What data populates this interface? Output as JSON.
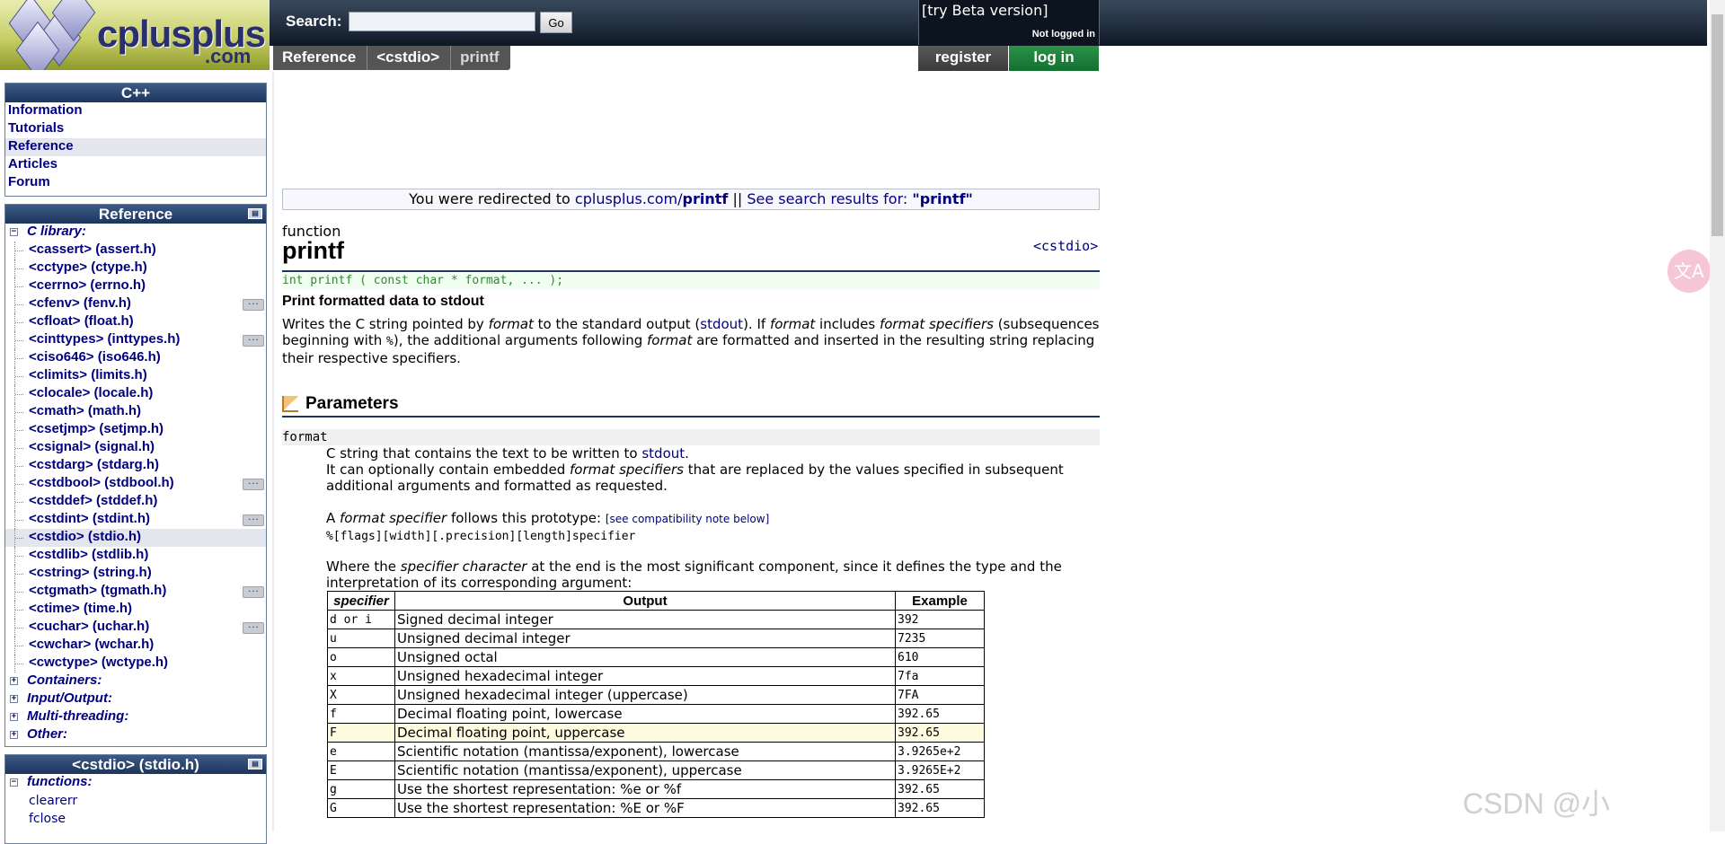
{
  "header": {
    "logo_text": "cplusplus",
    "logo_suffix": ".com",
    "search_label": "Search:",
    "search_value": "",
    "go_label": "Go",
    "beta_link": "[try Beta version]",
    "login_status": "Not logged in",
    "register_label": "register",
    "login_label": "log in"
  },
  "breadcrumb": [
    "Reference",
    "<cstdio>",
    "printf"
  ],
  "sidebar": {
    "cpp_box": {
      "title": "C++",
      "items": [
        {
          "label": "Information",
          "selected": false
        },
        {
          "label": "Tutorials",
          "selected": false
        },
        {
          "label": "Reference",
          "selected": true
        },
        {
          "label": "Articles",
          "selected": false
        },
        {
          "label": "Forum",
          "selected": false
        }
      ]
    },
    "reference_box": {
      "title": "Reference",
      "category": "C library:",
      "headers": [
        {
          "label": "<cassert> (assert.h)",
          "cpp11": false
        },
        {
          "label": "<cctype> (ctype.h)",
          "cpp11": false
        },
        {
          "label": "<cerrno> (errno.h)",
          "cpp11": false
        },
        {
          "label": "<cfenv> (fenv.h)",
          "cpp11": true
        },
        {
          "label": "<cfloat> (float.h)",
          "cpp11": false
        },
        {
          "label": "<cinttypes> (inttypes.h)",
          "cpp11": true
        },
        {
          "label": "<ciso646> (iso646.h)",
          "cpp11": false
        },
        {
          "label": "<climits> (limits.h)",
          "cpp11": false
        },
        {
          "label": "<clocale> (locale.h)",
          "cpp11": false
        },
        {
          "label": "<cmath> (math.h)",
          "cpp11": false
        },
        {
          "label": "<csetjmp> (setjmp.h)",
          "cpp11": false
        },
        {
          "label": "<csignal> (signal.h)",
          "cpp11": false
        },
        {
          "label": "<cstdarg> (stdarg.h)",
          "cpp11": false
        },
        {
          "label": "<cstdbool> (stdbool.h)",
          "cpp11": true
        },
        {
          "label": "<cstddef> (stddef.h)",
          "cpp11": false
        },
        {
          "label": "<cstdint> (stdint.h)",
          "cpp11": true
        },
        {
          "label": "<cstdio> (stdio.h)",
          "cpp11": false,
          "selected": true
        },
        {
          "label": "<cstdlib> (stdlib.h)",
          "cpp11": false
        },
        {
          "label": "<cstring> (string.h)",
          "cpp11": false
        },
        {
          "label": "<ctgmath> (tgmath.h)",
          "cpp11": true
        },
        {
          "label": "<ctime> (time.h)",
          "cpp11": false
        },
        {
          "label": "<cuchar> (uchar.h)",
          "cpp11": true
        },
        {
          "label": "<cwchar> (wchar.h)",
          "cpp11": false
        },
        {
          "label": "<cwctype> (wctype.h)",
          "cpp11": false
        }
      ],
      "other_categories": [
        "Containers:",
        "Input/Output:",
        "Multi-threading:",
        "Other:"
      ]
    },
    "cstdio_box": {
      "title": "<cstdio> (stdio.h)",
      "category": "functions:",
      "functions": [
        "clearerr",
        "fclose"
      ]
    }
  },
  "main": {
    "redirect": {
      "prefix": "You were redirected to ",
      "link1_host": "cplusplus.com/",
      "link1_page": "printf",
      "separator": " || ",
      "link2": "See search results for: ",
      "query": "\"printf\""
    },
    "kind": "function",
    "title": "printf",
    "header_tag": "<cstdio>",
    "prototype": "int printf ( const char * format, ... );",
    "short_description": "Print formatted data to stdout",
    "description": {
      "t1": "Writes the C string pointed by ",
      "t2": "format",
      "t3": " to the standard output (",
      "t4": "stdout",
      "t5": "). If ",
      "t6": "format",
      "t7": " includes ",
      "t8": "format specifiers",
      "t9": " (subsequences beginning with ",
      "t10": "%",
      "t11": "), the additional arguments following ",
      "t12": "format",
      "t13": " are formatted and inserted in the resulting string replacing their respective specifiers."
    },
    "parameters_title": "Parameters",
    "param_name": "format",
    "param": {
      "l1a": "C string that contains the text to be written to ",
      "l1b": "stdout",
      "l1c": ".",
      "l2a": "It can optionally contain embedded ",
      "l2b": "format specifiers",
      "l2c": " that are replaced by the values specified in subsequent additional arguments and formatted as requested.",
      "l3a": "A ",
      "l3b": "format specifier",
      "l3c": " follows this prototype: ",
      "l3d": "[see compatibility note below]",
      "proto": "%[flags][width][.precision][length]specifier",
      "l4a": "Where the ",
      "l4b": "specifier character",
      "l4c": " at the end is the most significant component, since it defines the type and the interpretation of its corresponding argument:"
    },
    "table": {
      "headers": [
        "specifier",
        "Output",
        "Example"
      ],
      "rows": [
        {
          "spec": "d or i",
          "output": "Signed decimal integer",
          "example": "392",
          "hl": false
        },
        {
          "spec": "u",
          "output": "Unsigned decimal integer",
          "example": "7235",
          "hl": false
        },
        {
          "spec": "o",
          "output": "Unsigned octal",
          "example": "610",
          "hl": false
        },
        {
          "spec": "x",
          "output": "Unsigned hexadecimal integer",
          "example": "7fa",
          "hl": false
        },
        {
          "spec": "X",
          "output": "Unsigned hexadecimal integer (uppercase)",
          "example": "7FA",
          "hl": false
        },
        {
          "spec": "f",
          "output": "Decimal floating point, lowercase",
          "example": "392.65",
          "hl": false
        },
        {
          "spec": "F",
          "output": "Decimal floating point, uppercase",
          "example": "392.65",
          "hl": true
        },
        {
          "spec": "e",
          "output": "Scientific notation (mantissa/exponent), lowercase",
          "example": "3.9265e+2",
          "hl": false
        },
        {
          "spec": "E",
          "output": "Scientific notation (mantissa/exponent), uppercase",
          "example": "3.9265E+2",
          "hl": false
        },
        {
          "spec": "g",
          "output": "Use the shortest representation: %e or %f",
          "example": "392.65",
          "hl": false
        },
        {
          "spec": "G",
          "output": "Use the shortest representation: %E or %F",
          "example": "392.65",
          "hl": false
        }
      ]
    }
  },
  "overlay": {
    "translate_icon": "translate-icon",
    "watermark": "CSDN @小"
  },
  "colors": {
    "link": "#00007f",
    "header_dark": "#1c2838",
    "login_green": "#127030",
    "highlight_row": "#fffbe0"
  }
}
